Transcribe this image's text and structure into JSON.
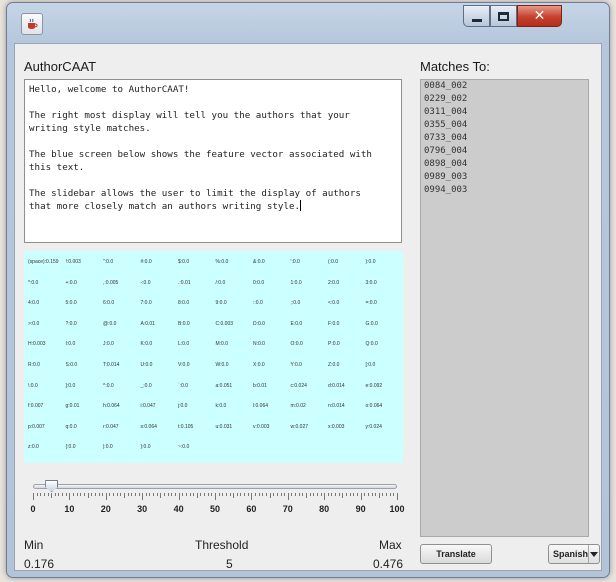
{
  "window": {
    "title": "AuthorCAAT",
    "app_icon": "java-cup-icon",
    "controls": [
      "minimize-icon",
      "maximize-icon",
      "close-icon"
    ],
    "close_glyph": "✕"
  },
  "left_panel": {
    "title": "AuthorCAAT",
    "text_lines": [
      "Hello, welcome to AuthorCAAT!",
      "",
      "The right most display will tell you the authors that your",
      "writing style matches.",
      "",
      "The blue screen below shows the feature vector associated with",
      "this text.",
      "",
      "The slidebar allows the user to limit the display of authors",
      "that more closely match an authors writing style."
    ],
    "feature_panel_color": "#ccffff",
    "features": [
      [
        "(space):0.159",
        "!:0.003",
        "\":0.0",
        "#:0.0",
        "$:0.0",
        "%:0.0",
        "&:0.0",
        "':0.0",
        "(:0.0",
        "):0.0"
      ],
      [
        "*:0.0",
        "+:0.0",
        ",:0.005",
        "-:0.0",
        ".:0.01",
        "/:0.0",
        "0:0.0",
        "1:0.0",
        "2:0.0",
        "3:0.0"
      ],
      [
        "4:0.0",
        "5:0.0",
        "6:0.0",
        "7:0.0",
        "8:0.0",
        "9:0.0",
        "::0.0",
        ";:0.0",
        "<:0.0",
        "=:0.0"
      ],
      [
        ">:0.0",
        "?:0.0",
        "@:0.0",
        "A:0.01",
        "B:0.0",
        "C:0.003",
        "D:0.0",
        "E:0.0",
        "F:0.0",
        "G:0.0"
      ],
      [
        "H:0.003",
        "I:0.0",
        "J:0.0",
        "K:0.0",
        "L:0.0",
        "M:0.0",
        "N:0.0",
        "O:0.0",
        "P:0.0",
        "Q:0.0"
      ],
      [
        "R:0.0",
        "S:0.0",
        "T:0.014",
        "U:0.0",
        "V:0.0",
        "W:0.0",
        "X:0.0",
        "Y:0.0",
        "Z:0.0",
        "[:0.0"
      ],
      [
        "\\:0.0",
        "]:0.0",
        "^:0.0",
        "_:0.0",
        "`:0.0",
        "a:0.051",
        "b:0.01",
        "c:0.024",
        "d:0.014",
        "e:0.092"
      ],
      [
        "f:0.007",
        "g:0.01",
        "h:0.064",
        "i:0.047",
        "j:0.0",
        "k:0.0",
        "l:0.064",
        "m:0.02",
        "n:0.014",
        "o:0.064"
      ],
      [
        "p:0.007",
        "q:0.0",
        "r:0.047",
        "s:0.064",
        "t:0.105",
        "u:0.031",
        "v:0.003",
        "w:0.027",
        "x:0.003",
        "y:0.024"
      ],
      [
        "z:0.0",
        "{:0.0",
        "|:0.0",
        "}:0.0",
        "~:0.0"
      ]
    ]
  },
  "slider": {
    "value_fraction": 0.05,
    "tick_labels": [
      "0",
      "10",
      "20",
      "30",
      "40",
      "50",
      "60",
      "70",
      "80",
      "90",
      "100"
    ]
  },
  "stats": {
    "min_label": "Min",
    "min_value": "0.176",
    "threshold_label": "Threshold",
    "threshold_value": "5",
    "max_label": "Max",
    "max_value": "0.476"
  },
  "right_panel": {
    "title": "Matches To:",
    "matches": [
      "0084_002",
      "0229_002",
      "0311_004",
      "0355_004",
      "0733_004",
      "0796_004",
      "0898_004",
      "0989_003",
      "0994_003"
    ],
    "translate_label": "Translate",
    "language_value": "Spanish"
  }
}
